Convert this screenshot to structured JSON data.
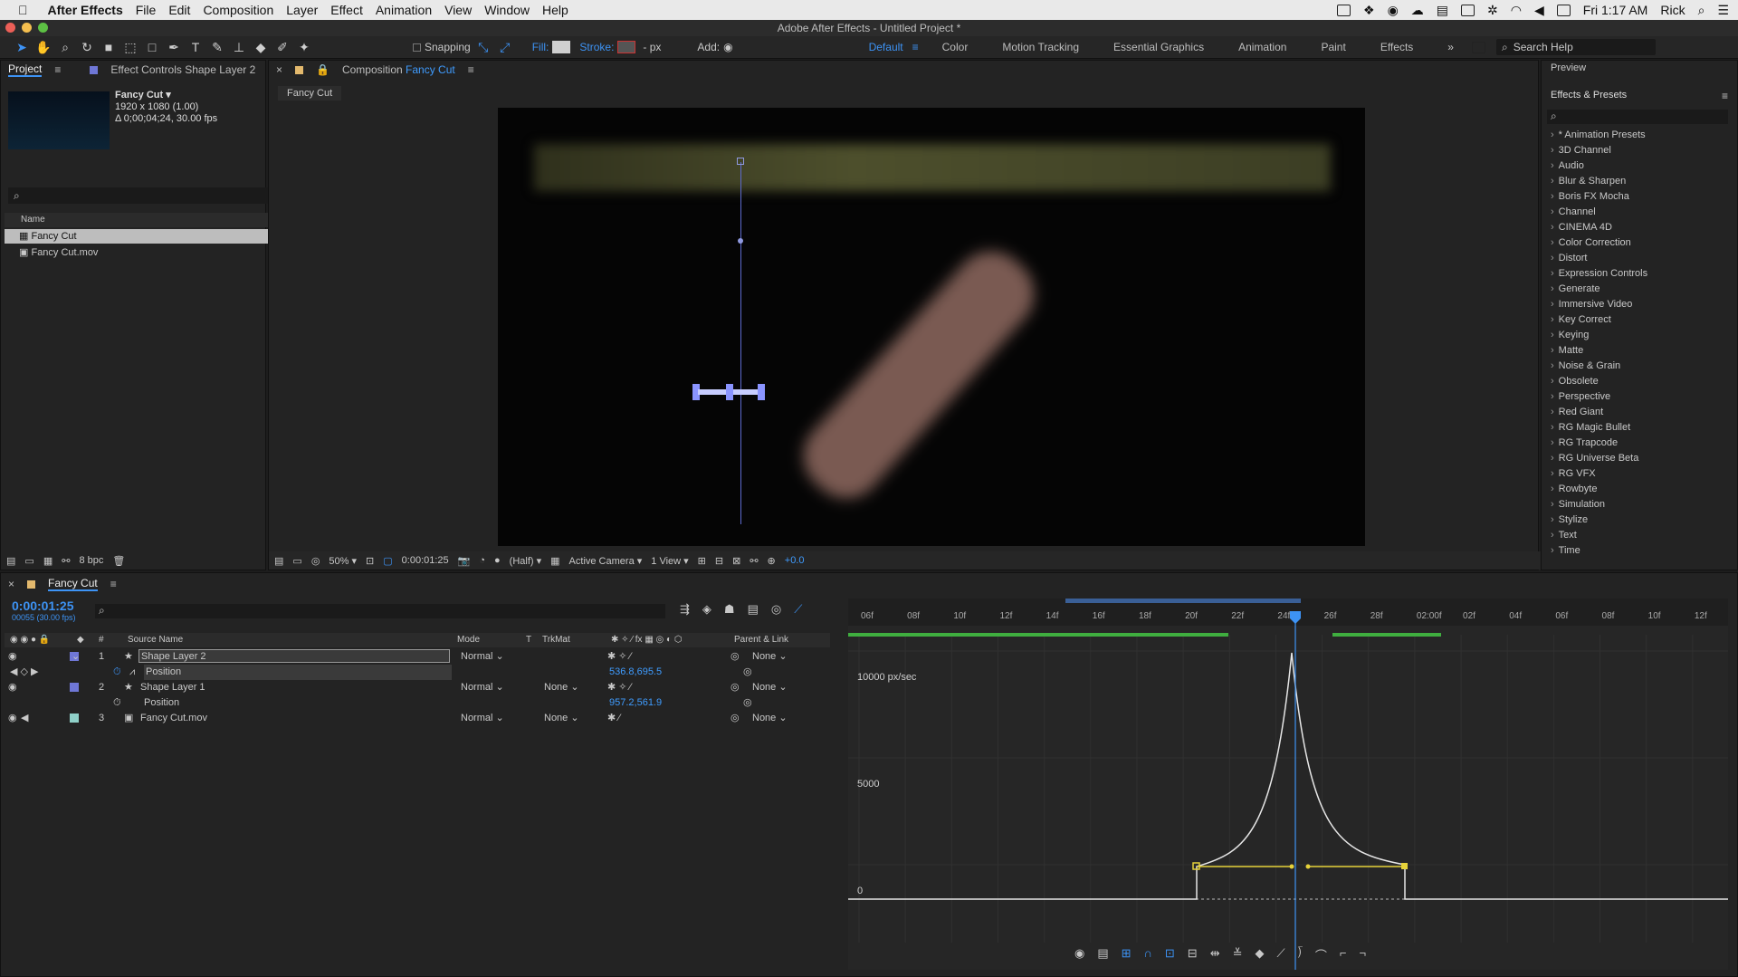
{
  "menubar": {
    "app": "After Effects",
    "items": [
      "File",
      "Edit",
      "Composition",
      "Layer",
      "Effect",
      "Animation",
      "View",
      "Window",
      "Help"
    ],
    "clock": "Fri 1:17 AM",
    "user": "Rick"
  },
  "window_title": "Adobe After Effects - Untitled Project *",
  "toolbar": {
    "snapping": "Snapping",
    "fill_label": "Fill:",
    "stroke_label": "Stroke:",
    "stroke_unit": "- px",
    "add_label": "Add:",
    "workspaces": [
      "Default",
      "Color",
      "Motion Tracking",
      "Essential Graphics",
      "Animation",
      "Paint",
      "Effects"
    ],
    "search_placeholder": "Search Help"
  },
  "project_panel": {
    "tab_project": "Project",
    "tab_effect_controls": "Effect Controls Shape Layer 2",
    "comp_name": "Fancy Cut ▾",
    "comp_size": "1920 x 1080 (1.00)",
    "comp_duration": "Δ 0;00;04;24, 30.00 fps",
    "column_name": "Name",
    "items": [
      "Fancy Cut",
      "Fancy Cut.mov"
    ],
    "bpc": "8 bpc"
  },
  "composition_panel": {
    "title": "Composition",
    "comp_name": "Fancy Cut",
    "tab": "Fancy Cut",
    "zoom": "50%",
    "timecode": "0:00:01:25",
    "resolution": "(Half)",
    "camera": "Active Camera",
    "views": "1 View",
    "exposure": "+0.0"
  },
  "right_panel": {
    "preview_tab": "Preview",
    "effects_title": "Effects & Presets",
    "effects": [
      "* Animation Presets",
      "3D Channel",
      "Audio",
      "Blur & Sharpen",
      "Boris FX Mocha",
      "Channel",
      "CINEMA 4D",
      "Color Correction",
      "Distort",
      "Expression Controls",
      "Generate",
      "Immersive Video",
      "Key Correct",
      "Keying",
      "Matte",
      "Noise & Grain",
      "Obsolete",
      "Perspective",
      "Red Giant",
      "RG Magic Bullet",
      "RG Trapcode",
      "RG Universe Beta",
      "RG VFX",
      "Rowbyte",
      "Simulation",
      "Stylize",
      "Text",
      "Time"
    ]
  },
  "timeline": {
    "tab": "Fancy Cut",
    "timecode": "0:00:01:25",
    "frame_info": "00055 (30.00 fps)",
    "columns": {
      "source": "Source Name",
      "mode": "Mode",
      "t": "T",
      "trkmat": "TrkMat",
      "parent": "Parent & Link",
      "num": "#"
    },
    "layers": [
      {
        "num": "1",
        "name": "Shape Layer 2",
        "mode": "Normal",
        "trkmat": "",
        "parent": "None",
        "color": "#6f77d6"
      },
      {
        "num": "2",
        "name": "Shape Layer 1",
        "mode": "Normal",
        "trkmat": "None",
        "parent": "None",
        "color": "#6f77d6"
      },
      {
        "num": "3",
        "name": "Fancy Cut.mov",
        "mode": "Normal",
        "trkmat": "None",
        "parent": "None",
        "color": "#8fd0c8"
      }
    ],
    "props": [
      {
        "name": "Position",
        "value": "536.8,695.5"
      },
      {
        "name": "Position",
        "value": "957.2,561.9"
      }
    ],
    "ruler": [
      "06f",
      "08f",
      "10f",
      "12f",
      "14f",
      "16f",
      "18f",
      "20f",
      "22f",
      "24f",
      "26f",
      "28f",
      "02:00f",
      "02f",
      "04f",
      "06f",
      "08f",
      "10f",
      "12f"
    ],
    "graph_labels": [
      "10000 px/sec",
      "5000",
      "0"
    ],
    "accent": "#3d93f5",
    "curve_color": "#e6e6e6",
    "handle_color": "#e6d23a"
  }
}
